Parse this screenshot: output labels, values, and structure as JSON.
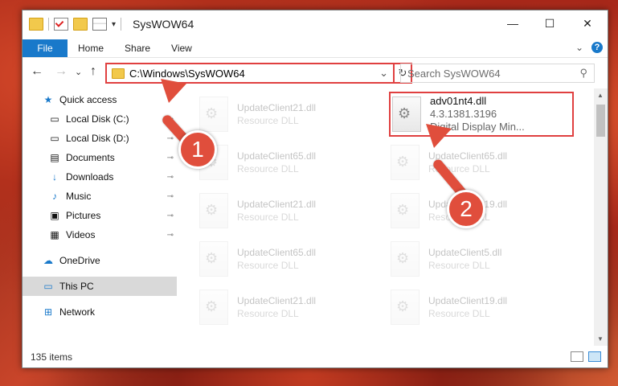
{
  "window": {
    "title": "SysWOW64",
    "minimize": "—",
    "maximize": "☐",
    "close": "✕"
  },
  "ribbon": {
    "file": "File",
    "tabs": [
      "Home",
      "Share",
      "View"
    ],
    "expand": "⌄",
    "help": "?"
  },
  "address": {
    "path": "C:\\Windows\\SysWOW64",
    "refresh": "↻",
    "dropdown": "⌄"
  },
  "search": {
    "placeholder": "Search SysWOW64"
  },
  "nav": {
    "back": "←",
    "forward": "→",
    "recent": "⌄",
    "up": "↑"
  },
  "sidebar": {
    "items": [
      {
        "label": "Quick access",
        "icon": "★"
      },
      {
        "label": "Local Disk (C:)",
        "icon": "▭",
        "pin": "📌"
      },
      {
        "label": "Local Disk (D:)",
        "icon": "▭",
        "pin": "📌"
      },
      {
        "label": "Documents",
        "icon": "▤",
        "pin": "📌"
      },
      {
        "label": "Downloads",
        "icon": "↓",
        "pin": "📌"
      },
      {
        "label": "Music",
        "icon": "♪",
        "pin": "📌"
      },
      {
        "label": "Pictures",
        "icon": "▣",
        "pin": "📌"
      },
      {
        "label": "Videos",
        "icon": "▦",
        "pin": "📌"
      },
      {
        "label": "OneDrive",
        "icon": "☁"
      },
      {
        "label": "This PC",
        "icon": "▭"
      },
      {
        "label": "Network",
        "icon": "⊞"
      }
    ]
  },
  "files": [
    {
      "name": "UpdateClient21.dll",
      "sub": "Resource DLL"
    },
    {
      "name": "adv01nt4.dll",
      "version": "4.3.1381.3196",
      "desc": "Digital Display Min..."
    },
    {
      "name": "UpdateClient65.dll",
      "sub": "Resource DLL"
    },
    {
      "name": "UpdateClient65.dll",
      "sub": "Resource DLL"
    },
    {
      "name": "UpdateClient21.dll",
      "sub": "Resource DLL"
    },
    {
      "name": "UpdateClient19.dll",
      "sub": "Resource DLL"
    },
    {
      "name": "UpdateClient65.dll",
      "sub": "Resource DLL"
    },
    {
      "name": "UpdateClient5.dll",
      "sub": "Resource DLL"
    },
    {
      "name": "UpdateClient21.dll",
      "sub": "Resource DLL"
    },
    {
      "name": "UpdateClient19.dll",
      "sub": "Resource DLL"
    }
  ],
  "status": {
    "count": "135 items"
  },
  "callouts": [
    "1",
    "2"
  ],
  "colors": {
    "accent": "#1979ca",
    "highlight": "#e04040"
  }
}
